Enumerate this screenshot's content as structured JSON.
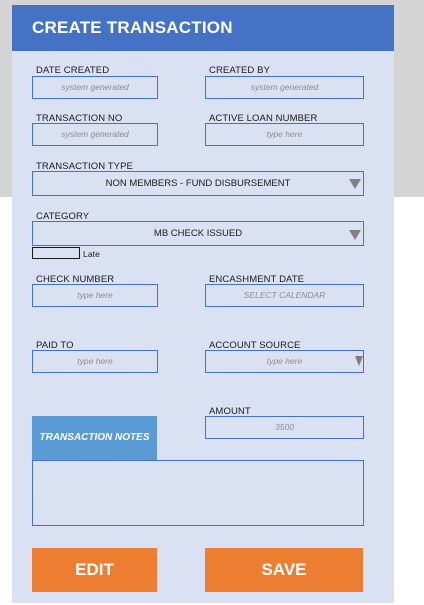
{
  "header": {
    "title": "CREATE TRANSACTION"
  },
  "fields": {
    "date_created": {
      "label": "DATE CREATED",
      "placeholder": "system generated"
    },
    "created_by": {
      "label": "CREATED BY",
      "placeholder": "system generated"
    },
    "transaction_no": {
      "label": "TRANSACTION NO",
      "placeholder": "system generated"
    },
    "active_loan_number": {
      "label": "ACTIVE LOAN NUMBER",
      "placeholder": "type here"
    },
    "transaction_type": {
      "label": "TRANSACTION TYPE",
      "value": "NON MEMBERS - FUND DISBURSEMENT"
    },
    "category": {
      "label": "CATEGORY",
      "value": "MB CHECK ISSUED"
    },
    "late": {
      "label": "Late"
    },
    "check_number": {
      "label": "CHECK NUMBER",
      "placeholder": "type here"
    },
    "encashment_date": {
      "label": "ENCASHMENT DATE",
      "placeholder": "SELECT CALENDAR"
    },
    "paid_to": {
      "label": "PAID TO",
      "placeholder": "type here"
    },
    "account_source": {
      "label": "ACCOUNT SOURCE",
      "placeholder": "type here"
    },
    "amount": {
      "label": "AMOUNT",
      "value": "3500"
    },
    "transaction_notes": {
      "label": "TRANSACTION NOTES"
    }
  },
  "buttons": {
    "edit": "EDIT",
    "save": "SAVE"
  },
  "colors": {
    "header_bg": "#4472c4",
    "panel_bg": "#dae1f3",
    "notes_header_bg": "#5b9bd5",
    "button_bg": "#ed7d31",
    "border": "#4472c4"
  }
}
